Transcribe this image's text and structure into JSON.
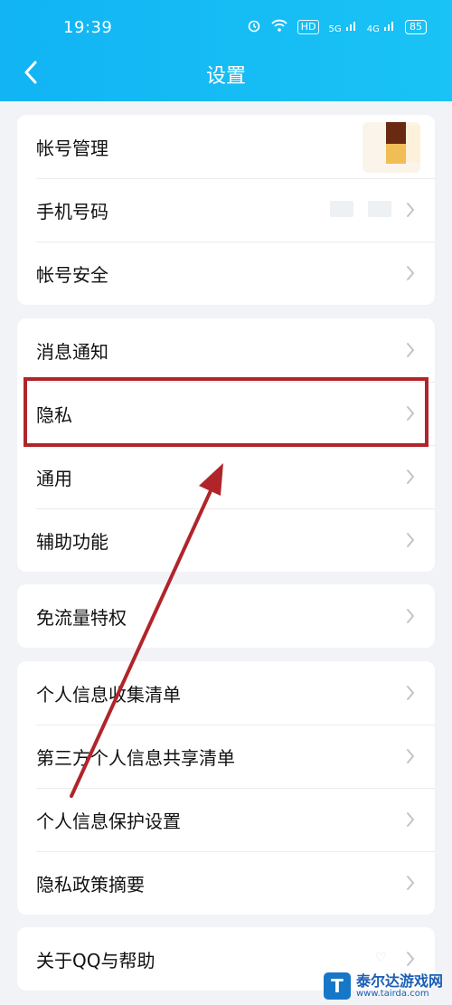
{
  "status_bar": {
    "time": "19:39",
    "hd_label": "HD",
    "net1": "5G",
    "net2": "4G",
    "battery": "85"
  },
  "header": {
    "title": "设置"
  },
  "groups": [
    {
      "items": [
        {
          "label": "帐号管理"
        },
        {
          "label": "手机号码"
        },
        {
          "label": "帐号安全"
        }
      ]
    },
    {
      "items": [
        {
          "label": "消息通知"
        },
        {
          "label": "隐私"
        },
        {
          "label": "通用"
        },
        {
          "label": "辅助功能"
        }
      ]
    },
    {
      "items": [
        {
          "label": "免流量特权"
        }
      ]
    },
    {
      "items": [
        {
          "label": "个人信息收集清单"
        },
        {
          "label": "第三方个人信息共享清单"
        },
        {
          "label": "个人信息保护设置"
        },
        {
          "label": "隐私政策摘要"
        }
      ]
    },
    {
      "items": [
        {
          "label": "关于QQ与帮助"
        }
      ]
    }
  ],
  "watermark": {
    "name": "泰尔达游戏网",
    "url": "www.tairda.com",
    "logo_letter": "T"
  },
  "colors": {
    "header": "#12b4f4",
    "highlight": "#b0252a",
    "background": "#f2f3f7"
  }
}
